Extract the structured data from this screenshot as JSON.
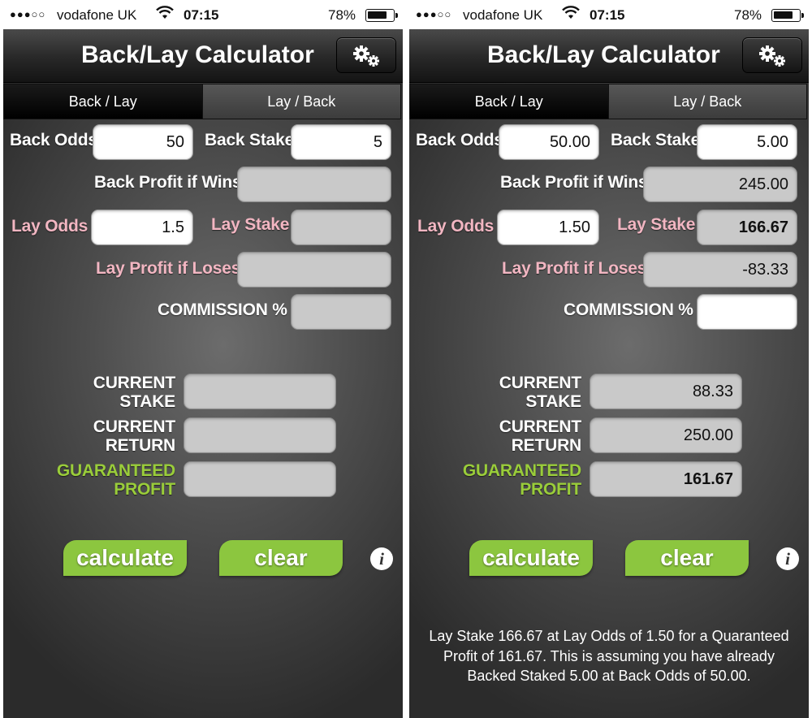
{
  "status_bar": {
    "signal": "●●●○○",
    "carrier": "vodafone UK",
    "time": "07:15",
    "battery_percent": "78%",
    "battery_level": 0.78,
    "wifi_icon": "wifi-icon"
  },
  "navbar": {
    "title": "Back/Lay Calculator",
    "settings_icon": "gears-icon"
  },
  "tabs": [
    {
      "label": "Back / Lay",
      "selected": true
    },
    {
      "label": "Lay / Back",
      "selected": false
    }
  ],
  "labels": {
    "back_odds": "Back Odds",
    "back_stake": "Back Stake",
    "back_profit_if_wins": "Back Profit if Wins",
    "lay_odds": "Lay Odds",
    "lay_stake": "Lay Stake",
    "lay_profit_if_loses": "Lay Profit if Loses",
    "commission": "COMMISSION %",
    "current_stake_1": "CURRENT",
    "current_stake_2": "STAKE",
    "current_return_1": "CURRENT",
    "current_return_2": "RETURN",
    "guaranteed_profit_1": "GUARANTEED",
    "guaranteed_profit_2": "PROFIT"
  },
  "buttons": {
    "calculate": "calculate",
    "clear": "clear",
    "info_icon": "info-icon"
  },
  "colors": {
    "pink_label": "#f2b6c2",
    "green_label": "#9acd3a",
    "button_green": "#8cc63f"
  },
  "screens": {
    "left": {
      "back_odds": "50",
      "back_stake": "5",
      "back_profit_if_wins": "",
      "lay_odds": "1.5",
      "lay_stake": "",
      "lay_profit_if_loses": "",
      "commission": "",
      "current_stake": "",
      "current_return": "",
      "guaranteed_profit": "",
      "message": ""
    },
    "right": {
      "back_odds": "50.00",
      "back_stake": "5.00",
      "back_profit_if_wins": "245.00",
      "lay_odds": "1.50",
      "lay_stake": "166.67",
      "lay_profit_if_loses": "-83.33",
      "commission": "",
      "current_stake": "88.33",
      "current_return": "250.00",
      "guaranteed_profit": "161.67",
      "message": "Lay Stake 166.67 at Lay Odds of 1.50 for a Quaranteed Profit of 161.67. This is assuming you have already Backed Staked 5.00 at Back Odds of 50.00."
    }
  }
}
